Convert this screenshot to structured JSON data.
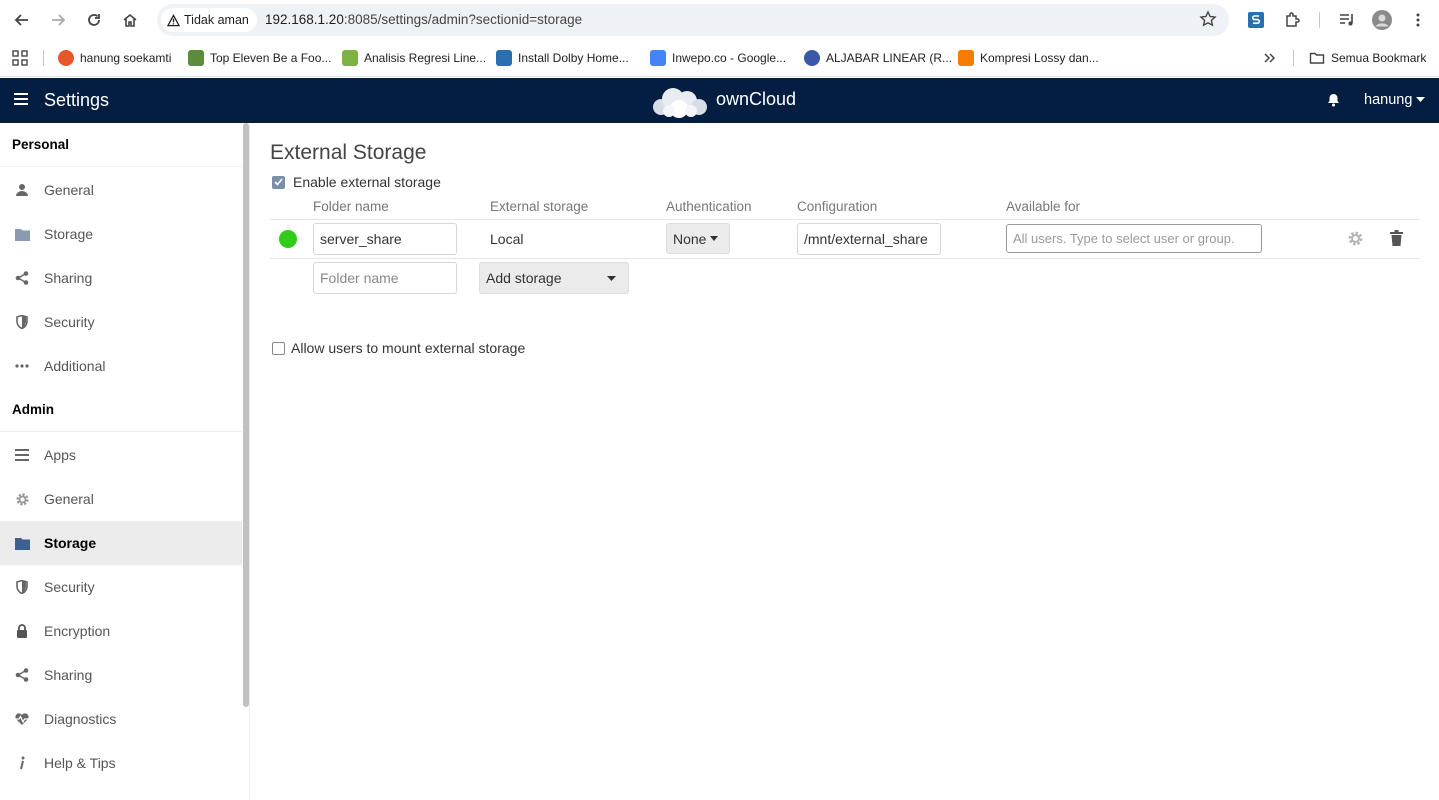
{
  "browser": {
    "security_label": "Tidak aman",
    "url_host": "192.168.1.20",
    "url_path": ":8085/settings/admin?sectionid=storage",
    "bookmarks": [
      {
        "label": "hanung soekamti",
        "color": "#e8572a"
      },
      {
        "label": "Top Eleven Be a Foo...",
        "color": "#5a8c3a"
      },
      {
        "label": "Analisis Regresi Line...",
        "color": "#7cb342"
      },
      {
        "label": "Install Dolby Home...",
        "color": "#2a6fb0"
      },
      {
        "label": "Inwepo.co - Google...",
        "color": "#4285f4"
      },
      {
        "label": "ALJABAR LINEAR (R...",
        "color": "#3858a8"
      },
      {
        "label": "Kompresi Lossy dan...",
        "color": "#f57c00"
      }
    ],
    "all_bookmarks_label": "Semua Bookmark"
  },
  "header": {
    "app_title": "Settings",
    "logo_text": "ownCloud",
    "user": "hanung"
  },
  "sidebar": {
    "personal_heading": "Personal",
    "personal_items": [
      {
        "label": "General",
        "icon": "user-icon"
      },
      {
        "label": "Storage",
        "icon": "folder-icon"
      },
      {
        "label": "Sharing",
        "icon": "share-icon"
      },
      {
        "label": "Security",
        "icon": "shield-icon"
      },
      {
        "label": "Additional",
        "icon": "more-icon"
      }
    ],
    "admin_heading": "Admin",
    "admin_items": [
      {
        "label": "Apps",
        "icon": "apps-icon"
      },
      {
        "label": "General",
        "icon": "gear-icon"
      },
      {
        "label": "Storage",
        "icon": "folder-icon",
        "active": true
      },
      {
        "label": "Security",
        "icon": "shield-icon"
      },
      {
        "label": "Encryption",
        "icon": "lock-icon"
      },
      {
        "label": "Sharing",
        "icon": "share-icon"
      },
      {
        "label": "Diagnostics",
        "icon": "pulse-icon"
      },
      {
        "label": "Help & Tips",
        "icon": "info-icon"
      }
    ]
  },
  "main": {
    "title": "External Storage",
    "enable_label": "Enable external storage",
    "columns": [
      "Folder name",
      "External storage",
      "Authentication",
      "Configuration",
      "Available for"
    ],
    "mount": {
      "folder_name": "server_share",
      "storage": "Local",
      "auth": "None",
      "configuration": "/mnt/external_share",
      "available_placeholder": "All users. Type to select user or group.",
      "status_color": "#2fcc19"
    },
    "new_row": {
      "folder_placeholder": "Folder name",
      "add_storage": "Add storage"
    },
    "allow_users_label": "Allow users to mount external storage"
  }
}
